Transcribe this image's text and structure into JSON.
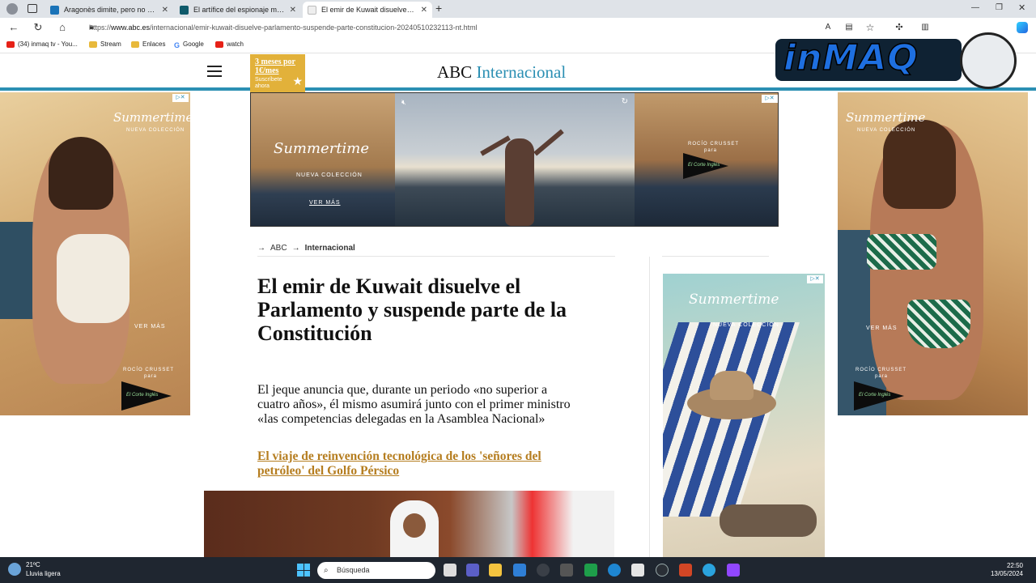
{
  "browser": {
    "tabs": [
      {
        "title": "Aragonès dimite, pero no aclara",
        "active": false
      },
      {
        "title": "El artífice del espionaje marroquí",
        "active": false
      },
      {
        "title": "El emir de Kuwait disuelve el Par",
        "active": true
      }
    ],
    "new_tab_label": "+",
    "url_prefix": "https://",
    "url_host": "www.abc.es",
    "url_path": "/internacional/emir-kuwait-disuelve-parlamento-suspende-parte-constitucion-20240510232113-nt.html"
  },
  "bookmarks": [
    {
      "label": "(34) inmaq tv - You...",
      "icon": "youtube-icon"
    },
    {
      "label": "Stream",
      "icon": "folder-icon"
    },
    {
      "label": "Enlaces",
      "icon": "folder-icon"
    },
    {
      "label": "Google",
      "icon": "google-icon"
    },
    {
      "label": "watch",
      "icon": "youtube-icon"
    }
  ],
  "header": {
    "brand": "ABC",
    "section": "Internacional",
    "promo_line1": "3 meses por",
    "promo_line2": "1€/mes",
    "promo_line3": "Suscríbete ahora"
  },
  "ads": {
    "brand_script": "Summertime",
    "collection": "NUEVA COLECCIÓN",
    "cta": "VER MÁS",
    "designer": "ROCÍO CRUSSET",
    "designer_sub": "para",
    "store": "El Corte Inglés",
    "adchoice": "▷✕"
  },
  "breadcrumb": {
    "arrow": "→",
    "root": "ABC",
    "current": "Internacional"
  },
  "article": {
    "headline": "El emir de Kuwait disuelve el Parlamento y suspende parte de la Constitución",
    "lead": "El jeque anuncia que, durante un periodo «no superior a cuatro años», él mismo asumirá junto con el primer ministro «las competencias delegadas en la Asamblea Nacional»",
    "related_link": "El viaje de reinvención tecnológica de los 'señores del petróleo' del Golfo Pérsico"
  },
  "logo": {
    "text": "inMAQ"
  },
  "taskbar": {
    "temperature": "21ºC",
    "weather": "Lluvia ligera",
    "search_placeholder": "Búsqueda",
    "time": "22:50",
    "date": "13/05/2024"
  }
}
